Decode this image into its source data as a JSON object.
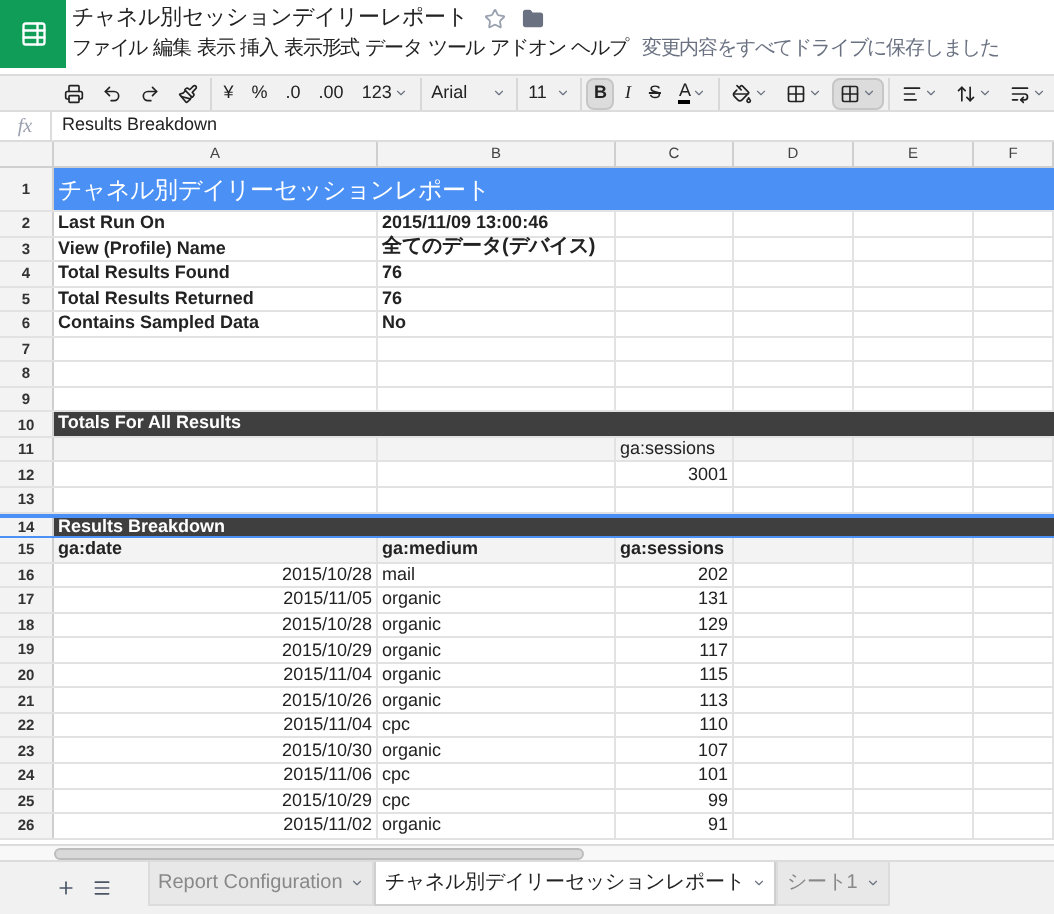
{
  "doc": {
    "title": "チャネル別セッションデイリーレポート",
    "save_status": "変更内容をすべてドライブに保存しました"
  },
  "menu": [
    "ファイル",
    "編集",
    "表示",
    "挿入",
    "表示形式",
    "データ",
    "ツール",
    "アドオン",
    "ヘルプ"
  ],
  "toolbar": {
    "currency": "¥",
    "percent": "%",
    "decrease_decimals": ".0",
    "increase_decimals": ".00",
    "more_formats": "123",
    "font": "Arial",
    "font_size": "11",
    "bold": {
      "label": "B",
      "on": true
    },
    "italic": {
      "label": "I",
      "on": false
    },
    "strike": {
      "label": "S",
      "on": false
    },
    "text_color": {
      "label": "A",
      "on": false
    },
    "merge_on": true
  },
  "formula_bar": {
    "label": "fx",
    "value": "Results Breakdown"
  },
  "columns": [
    "A",
    "B",
    "C",
    "D",
    "E",
    "F"
  ],
  "rows": [
    {
      "number": "1",
      "kind": "title",
      "selected": false,
      "cells": [
        "チャネル別デイリーセッションレポート"
      ]
    },
    {
      "number": "2",
      "kind": "info",
      "selected": false,
      "cells": [
        "Last Run On",
        "2015/11/09 13:00:46"
      ]
    },
    {
      "number": "3",
      "kind": "info",
      "selected": false,
      "cells": [
        "View (Profile) Name",
        "全てのデータ(デバイス)"
      ]
    },
    {
      "number": "4",
      "kind": "info",
      "selected": false,
      "cells": [
        "Total Results Found",
        "76"
      ]
    },
    {
      "number": "5",
      "kind": "info",
      "selected": false,
      "cells": [
        "Total Results Returned",
        "76"
      ]
    },
    {
      "number": "6",
      "kind": "info",
      "selected": false,
      "cells": [
        "Contains Sampled Data",
        "No"
      ]
    },
    {
      "number": "7",
      "kind": "blank",
      "selected": false,
      "cells": []
    },
    {
      "number": "8",
      "kind": "blank",
      "selected": false,
      "cells": []
    },
    {
      "number": "9",
      "kind": "blank",
      "selected": false,
      "cells": []
    },
    {
      "number": "10",
      "kind": "section",
      "selected": false,
      "cells": [
        "Totals For All Results"
      ]
    },
    {
      "number": "11",
      "kind": "subheader",
      "selected": false,
      "cells": [
        null,
        null,
        "ga:sessions"
      ]
    },
    {
      "number": "12",
      "kind": "data",
      "selected": false,
      "cells": [
        null,
        null,
        "3001"
      ]
    },
    {
      "number": "13",
      "kind": "blank",
      "selected": false,
      "cells": []
    },
    {
      "number": "14",
      "kind": "section",
      "selected": true,
      "cells": [
        "Results Breakdown"
      ]
    },
    {
      "number": "15",
      "kind": "header",
      "selected": false,
      "cells": [
        "ga:date",
        "ga:medium",
        "ga:sessions"
      ]
    },
    {
      "number": "16",
      "kind": "data",
      "selected": false,
      "cells": [
        "2015/10/28",
        "mail",
        "202"
      ]
    },
    {
      "number": "17",
      "kind": "data",
      "selected": false,
      "cells": [
        "2015/11/05",
        "organic",
        "131"
      ]
    },
    {
      "number": "18",
      "kind": "data",
      "selected": false,
      "cells": [
        "2015/10/28",
        "organic",
        "129"
      ]
    },
    {
      "number": "19",
      "kind": "data",
      "selected": false,
      "cells": [
        "2015/10/29",
        "organic",
        "117"
      ]
    },
    {
      "number": "20",
      "kind": "data",
      "selected": false,
      "cells": [
        "2015/11/04",
        "organic",
        "115"
      ]
    },
    {
      "number": "21",
      "kind": "data",
      "selected": false,
      "cells": [
        "2015/10/26",
        "organic",
        "113"
      ]
    },
    {
      "number": "22",
      "kind": "data",
      "selected": false,
      "cells": [
        "2015/11/04",
        "cpc",
        "110"
      ]
    },
    {
      "number": "23",
      "kind": "data",
      "selected": false,
      "cells": [
        "2015/10/30",
        "organic",
        "107"
      ]
    },
    {
      "number": "24",
      "kind": "data",
      "selected": false,
      "cells": [
        "2015/11/06",
        "cpc",
        "101"
      ]
    },
    {
      "number": "25",
      "kind": "data",
      "selected": false,
      "cells": [
        "2015/10/29",
        "cpc",
        "99"
      ]
    },
    {
      "number": "26",
      "kind": "data",
      "selected": false,
      "cells": [
        "2015/11/02",
        "organic",
        "91"
      ]
    }
  ],
  "sheets": [
    {
      "label": "Report Configuration",
      "selected": false
    },
    {
      "label": "チャネル別デイリーセッションレポート",
      "selected": true
    },
    {
      "label": "シート1",
      "selected": false
    }
  ]
}
